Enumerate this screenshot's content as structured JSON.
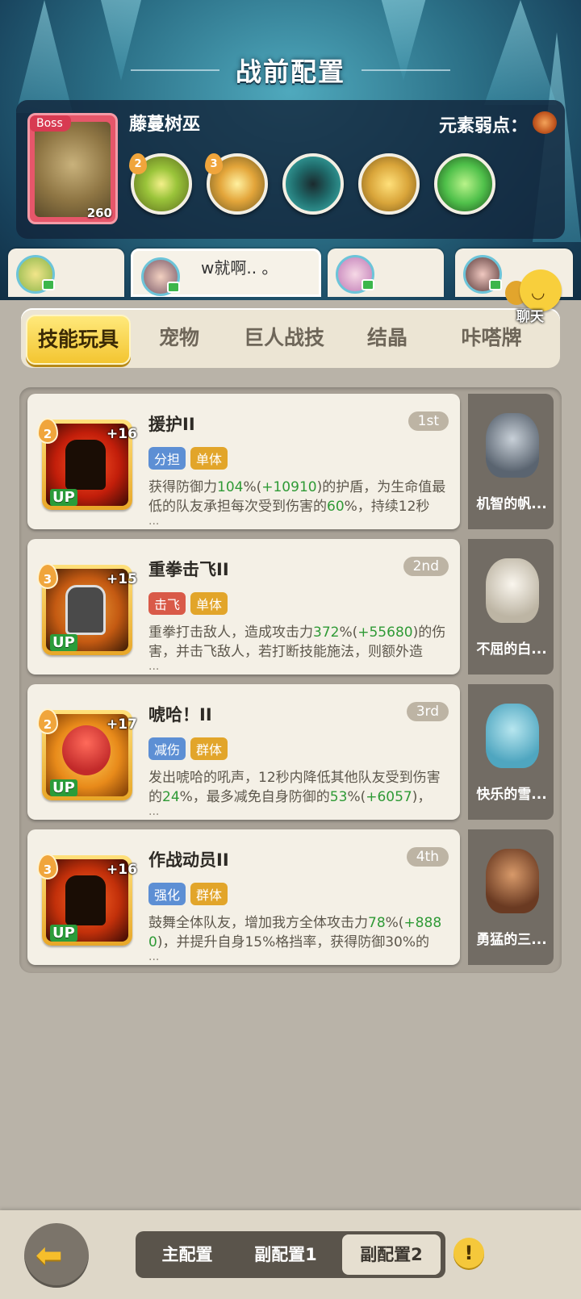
{
  "header": {
    "title": "战前配置"
  },
  "boss": {
    "tag": "Boss",
    "level": "260",
    "name": "藤蔓树巫",
    "weakness_label": "元素弱点：",
    "skills": [
      {
        "badge": "2",
        "icon": "green-burst-icon"
      },
      {
        "badge": "3",
        "icon": "fire-flame-icon"
      },
      {
        "badge": "",
        "icon": "dark-shadow-icon"
      },
      {
        "badge": "",
        "icon": "gold-spike-icon"
      },
      {
        "badge": "",
        "icon": "green-slime-icon"
      }
    ]
  },
  "team": {
    "members": [
      {
        "message": ""
      },
      {
        "message": "w就啊.. 。"
      },
      {
        "message": ""
      },
      {
        "message": ""
      }
    ]
  },
  "chat": {
    "label": "聊天"
  },
  "tabs": [
    {
      "label": "技能玩具",
      "active": true
    },
    {
      "label": "宠物",
      "active": false
    },
    {
      "label": "巨人战技",
      "active": false
    },
    {
      "label": "结晶",
      "active": false
    },
    {
      "label": "咔嗒牌",
      "active": false
    }
  ],
  "skills": [
    {
      "level": "2",
      "plus": "+16",
      "up": "UP",
      "name": "援护II",
      "rank": "1st",
      "tags": [
        "分担",
        "单体"
      ],
      "desc_parts": [
        "获得防御力",
        "104",
        "%(",
        "+10910",
        ")的护盾，为生命值最低的队友承担每次受到伤害的",
        "60",
        "%，持续12秒"
      ],
      "ellipsis": "...",
      "pet": "机智的帆..."
    },
    {
      "level": "3",
      "plus": "+15",
      "up": "UP",
      "name": "重拳击飞II",
      "rank": "2nd",
      "tags": [
        "击飞",
        "单体"
      ],
      "desc_parts": [
        "重拳打击敌人，造成攻击力",
        "372",
        "%(",
        "+55680",
        ")的伤害，并击飞敌人，若打断技能施法，则额外造",
        "",
        ""
      ],
      "ellipsis": "...",
      "pet": "不屈的白..."
    },
    {
      "level": "2",
      "plus": "+17",
      "up": "UP",
      "name": "唬哈！II",
      "rank": "3rd",
      "tags": [
        "减伤",
        "群体"
      ],
      "desc_parts": [
        "发出唬哈的吼声，12秒内降低其他队友受到伤害的",
        "24",
        "%，最多减免自身防御的",
        "53",
        "%(",
        "+6057",
        ")，"
      ],
      "ellipsis": "...",
      "pet": "快乐的雪..."
    },
    {
      "level": "3",
      "plus": "+16",
      "up": "UP",
      "name": "作战动员II",
      "rank": "4th",
      "tags": [
        "强化",
        "群体"
      ],
      "desc_parts": [
        "鼓舞全体队友，增加我方全体攻击力",
        "78",
        "%(",
        "+8880",
        ")，并提升自身15%格挡率，获得防御30%的",
        "",
        ""
      ],
      "ellipsis": "...",
      "pet": "勇猛的三..."
    }
  ],
  "footer": {
    "configs": [
      {
        "label": "主配置",
        "active": false
      },
      {
        "label": "副配置1",
        "active": false
      },
      {
        "label": "副配置2",
        "active": true
      }
    ],
    "warn": "!"
  },
  "colors": {
    "accent": "#f3c531",
    "highlight": "#2f9a36",
    "tag_blue": "#5d8fd4",
    "tag_red": "#d95a48",
    "tag_orange": "#e2a52a"
  }
}
